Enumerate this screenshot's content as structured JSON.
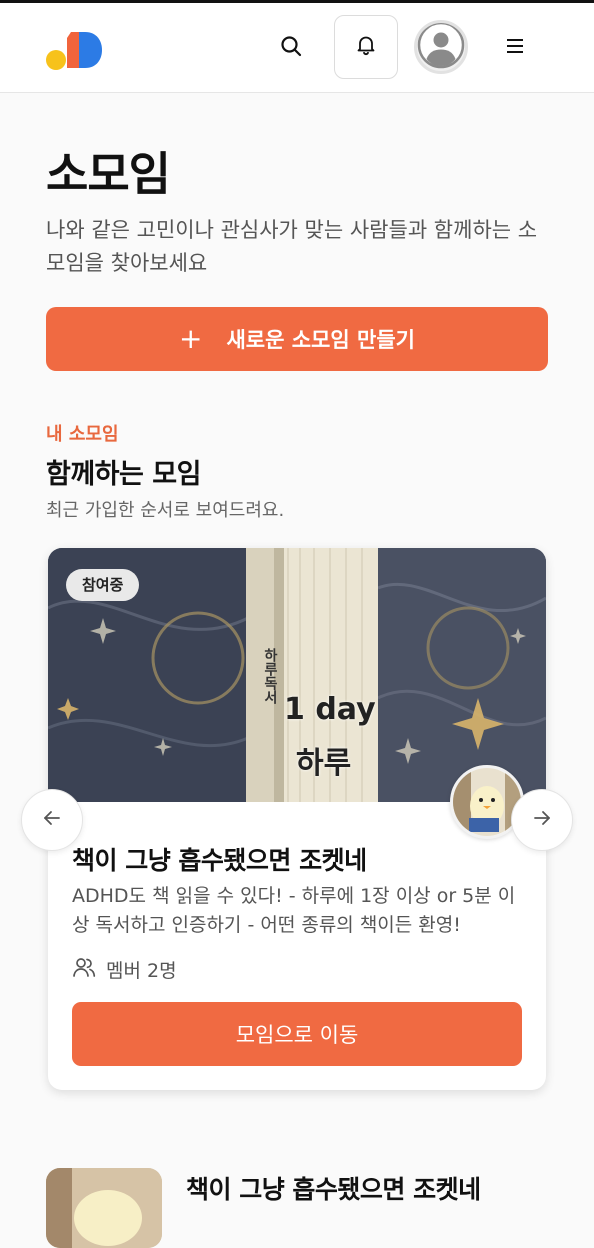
{
  "header": {
    "logo": "app-logo",
    "icons": [
      "search-icon",
      "bell-icon",
      "avatar-icon",
      "menu-icon"
    ]
  },
  "page": {
    "title": "소모임",
    "description": "나와 같은 고민이나 관심사가 맞는 사람들과 함께하는 소모임을 찾아보세요",
    "create_button": {
      "icon": "+",
      "label": "새로운 소모임 만들기"
    }
  },
  "my_groups": {
    "label": "내 소모임",
    "title": "함께하는 모임",
    "subtitle": "최근 가입한 순서로 보여드려요."
  },
  "featured_card": {
    "badge": "참여중",
    "image_text": {
      "line1": "1 day",
      "line2": "하루",
      "spine": "하루독서"
    },
    "title": "책이 그냥 흡수됐으면 조켓네",
    "description": "ADHD도 책 읽을 수 있다! - 하루에 1장 이상 or 5분 이상 독서하고 인증하기 - 어떤 종류의 책이든 환영!",
    "members": "멤버 2명",
    "button": "모임으로 이동"
  },
  "list": {
    "items": [
      {
        "title": "책이 그냥 흡수됐으면 조켓네"
      }
    ]
  },
  "colors": {
    "accent": "#f06a42",
    "label": "#e8683e",
    "logo_yellow": "#f7c21b",
    "logo_red": "#f1643c",
    "logo_blue": "#2c7be5"
  }
}
